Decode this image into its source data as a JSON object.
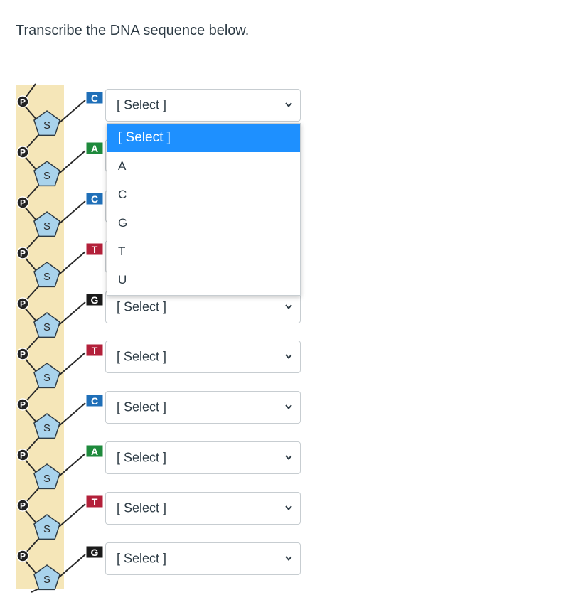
{
  "question": {
    "text": "Transcribe the DNA sequence below."
  },
  "dna": {
    "phosphate_label": "P",
    "sugar_label": "S",
    "bases": [
      {
        "letter": "C",
        "color": "#1f6fb8"
      },
      {
        "letter": "A",
        "color": "#1e8a3c"
      },
      {
        "letter": "C",
        "color": "#1f6fb8"
      },
      {
        "letter": "T",
        "color": "#b3203a"
      },
      {
        "letter": "G",
        "color": "#1a1a1a"
      },
      {
        "letter": "T",
        "color": "#b3203a"
      },
      {
        "letter": "C",
        "color": "#1f6fb8"
      },
      {
        "letter": "A",
        "color": "#1e8a3c"
      },
      {
        "letter": "T",
        "color": "#b3203a"
      },
      {
        "letter": "G",
        "color": "#1a1a1a"
      }
    ],
    "colors": {
      "backbone": "#f5e6b8",
      "sugar_fill": "#a9d3ec",
      "sugar_stroke": "#2f3b44",
      "phosphate_fill": "#222222"
    }
  },
  "selects": [
    {
      "value": "[ Select ]"
    },
    {
      "value": "[ Select ]"
    },
    {
      "value": "[ Select ]"
    },
    {
      "value": "[ Select ]"
    },
    {
      "value": "[ Select ]"
    },
    {
      "value": "[ Select ]"
    },
    {
      "value": "[ Select ]"
    },
    {
      "value": "[ Select ]"
    },
    {
      "value": "[ Select ]"
    },
    {
      "value": "[ Select ]"
    }
  ],
  "dropdown": {
    "options": [
      {
        "label": "[ Select ]",
        "selected": true
      },
      {
        "label": "A",
        "selected": false
      },
      {
        "label": "C",
        "selected": false
      },
      {
        "label": "G",
        "selected": false
      },
      {
        "label": "T",
        "selected": false
      },
      {
        "label": "U",
        "selected": false
      }
    ],
    "highlight_color": "#1e90ff"
  }
}
